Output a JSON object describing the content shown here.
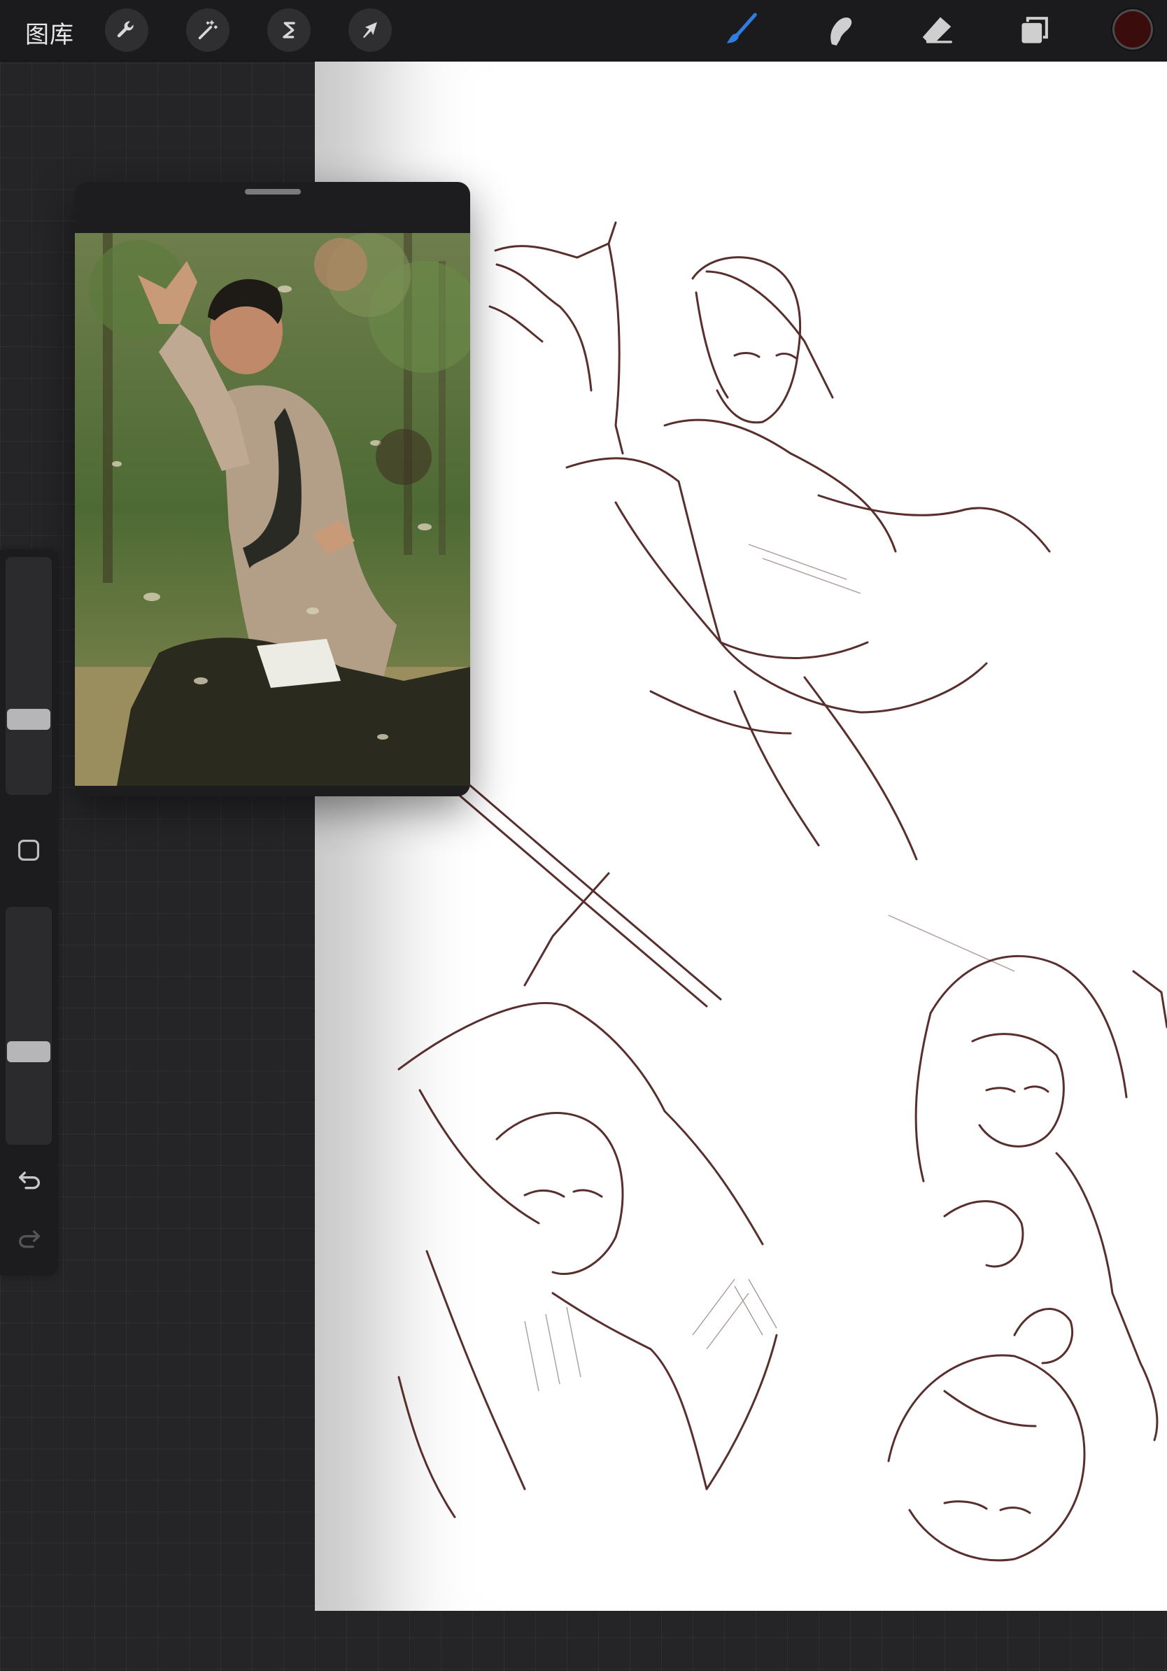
{
  "toolbar": {
    "gallery_label": "图库",
    "left_tools": [
      {
        "name": "actions",
        "icon": "wrench-icon"
      },
      {
        "name": "adjustments",
        "icon": "magic-wand-icon"
      },
      {
        "name": "selection",
        "icon": "selection-s-icon"
      },
      {
        "name": "transform",
        "icon": "arrow-cursor-icon"
      }
    ],
    "right_tools": [
      {
        "name": "brush",
        "icon": "brush-icon",
        "active": true
      },
      {
        "name": "smudge",
        "icon": "smudge-finger-icon",
        "active": false
      },
      {
        "name": "eraser",
        "icon": "eraser-icon",
        "active": false
      },
      {
        "name": "layers",
        "icon": "layers-icon",
        "active": false
      }
    ],
    "active_color": "#3a0d0c",
    "accent_color": "#2f7de1"
  },
  "sidebar": {
    "brush_size_level": 0.3,
    "opacity_level": 0.38,
    "modify_icon": "square-modify-icon",
    "undo_icon": "undo-arrow-icon",
    "redo_icon": "redo-arrow-icon",
    "redo_enabled": false
  },
  "reference_window": {
    "content": "reference-photo-martial-artist"
  },
  "canvas": {
    "content": "sketch-drawing-martial-artists",
    "stroke_color": "#4a1e1c"
  }
}
